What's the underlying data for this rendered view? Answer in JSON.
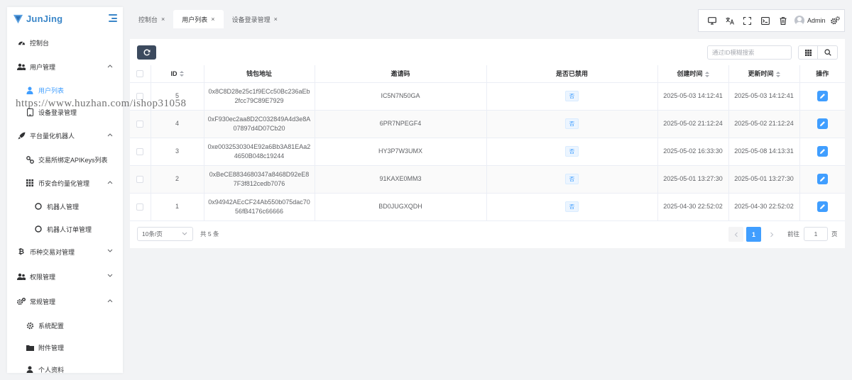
{
  "app": {
    "logo_text": "JunJing"
  },
  "sidebar": {
    "items": [
      {
        "label": "控制台",
        "icon": "dashboard-icon"
      },
      {
        "label": "用户管理",
        "icon": "users-icon",
        "expanded": true
      },
      {
        "label": "用户列表",
        "icon": "user-icon",
        "active": true
      },
      {
        "label": "设备登录管理",
        "icon": "device-icon"
      },
      {
        "label": "平台量化机器人",
        "icon": "rocket-icon",
        "expanded": true
      },
      {
        "label": "交易所绑定APIKeys列表",
        "icon": "key-icon"
      },
      {
        "label": "币安合约量化管理",
        "icon": "grid-icon",
        "expanded": true
      },
      {
        "label": "机器人管理",
        "icon": "circle-icon"
      },
      {
        "label": "机器人订单管理",
        "icon": "circle-icon"
      },
      {
        "label": "币种交易对管理",
        "icon": "bitcoin-icon",
        "expanded": false
      },
      {
        "label": "权限管理",
        "icon": "users-icon",
        "expanded": false
      },
      {
        "label": "常规管理",
        "icon": "gears-icon",
        "expanded": true
      },
      {
        "label": "系统配置",
        "icon": "gear-icon"
      },
      {
        "label": "附件管理",
        "icon": "folder-icon"
      },
      {
        "label": "个人资料",
        "icon": "user-icon"
      }
    ]
  },
  "tabs": [
    {
      "label": "控制台",
      "active": false
    },
    {
      "label": "用户列表",
      "active": true
    },
    {
      "label": "设备登录管理",
      "active": false
    }
  ],
  "tab_close": "×",
  "topbar": {
    "icons": [
      "monitor-icon",
      "translate-icon",
      "fullscreen-icon",
      "terminal-icon",
      "trash-icon"
    ],
    "user_name": "Admin"
  },
  "search": {
    "placeholder": "通过ID模糊搜索",
    "value": ""
  },
  "table": {
    "headers": {
      "id": "ID",
      "wallet": "钱包地址",
      "invite": "邀请码",
      "disabled": "是否已禁用",
      "created": "创建时间",
      "updated": "更新时间",
      "actions": "操作"
    },
    "rows": [
      {
        "id": "5",
        "wallet_1": "0x8C8D28e25c1f9ECc50Bc236aEb",
        "wallet_2": "2fcc79C89E7929",
        "invite": "IC5N7N50GA",
        "disabled": "否",
        "created": "2025-05-03 14:12:41",
        "updated": "2025-05-03 14:12:41"
      },
      {
        "id": "4",
        "wallet_1": "0xF930ec2aa8D2C032849A4d3e8A",
        "wallet_2": "07897d4D07Cb20",
        "invite": "6PR7NPEGF4",
        "disabled": "否",
        "created": "2025-05-02 21:12:24",
        "updated": "2025-05-02 21:12:24"
      },
      {
        "id": "3",
        "wallet_1": "0xe0032530304E92a6Bb3A81EAa2",
        "wallet_2": "4650B048c19244",
        "invite": "HY3P7W3UMX",
        "disabled": "否",
        "created": "2025-05-02 16:33:30",
        "updated": "2025-05-08 14:13:31"
      },
      {
        "id": "2",
        "wallet_1": "0xBeCE8834680347a8468D92eE8",
        "wallet_2": "7F3f812cedb7076",
        "invite": "91KAXE0MM3",
        "disabled": "否",
        "created": "2025-05-01 13:27:30",
        "updated": "2025-05-01 13:27:30"
      },
      {
        "id": "1",
        "wallet_1": "0x94942AEcCF24Ab550b075dac70",
        "wallet_2": "56fB4176c66666",
        "invite": "BD0JUGXQDH",
        "disabled": "否",
        "created": "2025-04-30 22:52:02",
        "updated": "2025-04-30 22:52:02"
      }
    ]
  },
  "pagination": {
    "page_size": "10条/页",
    "total": "共 5 条",
    "current_page": "1",
    "goto_label": "前往",
    "goto_value": "1",
    "page_suffix": "页"
  },
  "watermark": "https://www.huzhan.com/ishop31058",
  "colors": {
    "primary": "#409eff",
    "logo": "#3a86c8",
    "refresh_button": "#3c4a5e"
  }
}
